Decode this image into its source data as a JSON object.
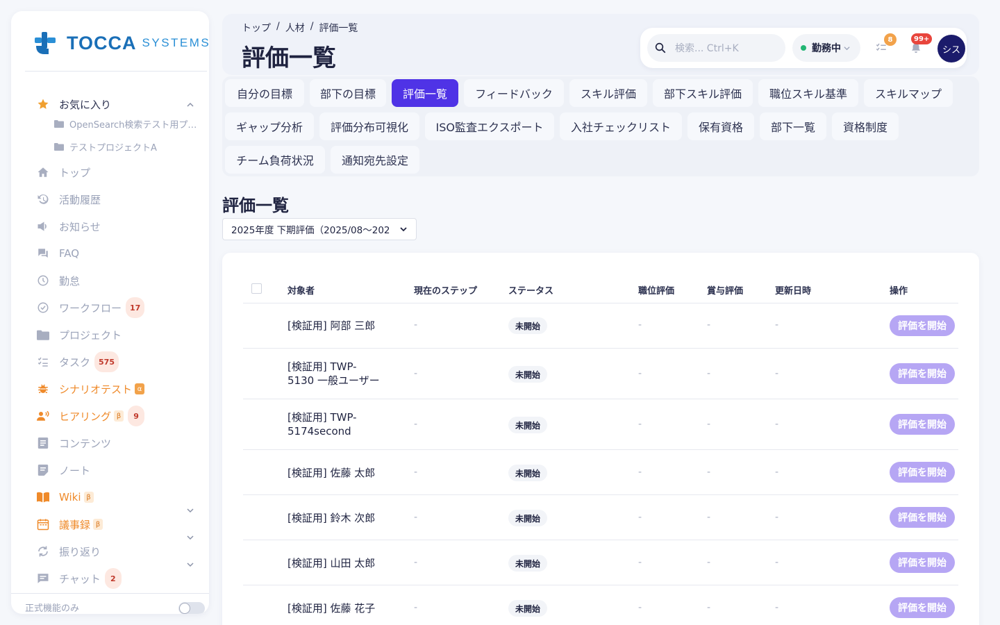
{
  "brand": {
    "name": "TOCCA",
    "sub": "SYSTEMS",
    "colors": {
      "primary": "#1a6fb7",
      "accent": "#4f33e6"
    }
  },
  "sidebar": {
    "favorites": {
      "label": "お気に入り",
      "icon": "star-icon",
      "children": [
        {
          "label": "OpenSearch検索テスト用プ…",
          "icon": "folder-icon"
        },
        {
          "label": "テストプロジェクトA",
          "icon": "folder-icon"
        }
      ]
    },
    "items": [
      {
        "label": "トップ",
        "icon": "home-icon"
      },
      {
        "label": "活動履歴",
        "icon": "history-icon"
      },
      {
        "label": "お知らせ",
        "icon": "megaphone-icon"
      },
      {
        "label": "FAQ",
        "icon": "chat-bubbles-icon"
      },
      {
        "label": "勤怠",
        "icon": "clock-icon"
      },
      {
        "label": "ワークフロー",
        "icon": "check-circle-icon",
        "badge": "17"
      },
      {
        "label": "プロジェクト",
        "icon": "folder-icon"
      },
      {
        "label": "タスク",
        "icon": "checklist-icon",
        "badge": "575"
      },
      {
        "label": "シナリオテスト",
        "icon": "bug-icon",
        "tag": "α"
      },
      {
        "label": "ヒアリング",
        "icon": "speaker-person-icon",
        "tag": "β",
        "badge": "9"
      },
      {
        "label": "コンテンツ",
        "icon": "document-icon"
      },
      {
        "label": "ノート",
        "icon": "note-icon"
      },
      {
        "label": "Wiki",
        "icon": "book-icon",
        "tag": "β"
      },
      {
        "label": "議事録",
        "icon": "calendar-icon",
        "tag": "β"
      },
      {
        "label": "振り返り",
        "icon": "refresh-icon"
      },
      {
        "label": "チャット",
        "icon": "chat-icon",
        "badge": "2"
      }
    ],
    "footer": {
      "label": "正式機能のみ"
    }
  },
  "header": {
    "breadcrumb": [
      "トップ",
      "人材",
      "評価一覧"
    ],
    "separator": "/",
    "title": "評価一覧",
    "search_placeholder": "検索... Ctrl+K",
    "status": "勤務中",
    "task_badge": "8",
    "notification_badge": "99+",
    "avatar": "シス"
  },
  "tabs": [
    "自分の目標",
    "部下の目標",
    "評価一覧",
    "フィードバック",
    "スキル評価",
    "部下スキル評価",
    "職位スキル基準",
    "スキルマップ",
    "ギャップ分析",
    "評価分布可視化",
    "ISO監査エクスポート",
    "入社チェックリスト",
    "保有資格",
    "部下一覧",
    "資格制度",
    "チーム負荷状況",
    "通知宛先設定"
  ],
  "active_tab": "評価一覧",
  "section": {
    "title": "評価一覧",
    "period": "2025年度 下期評価（2025/08～202"
  },
  "table": {
    "columns": [
      "対象者",
      "現在のステップ",
      "ステータス",
      "職位評価",
      "賞与評価",
      "更新日時",
      "操作"
    ],
    "rows": [
      {
        "name": "[検証用] 阿部 三郎",
        "step": "-",
        "status": "未開始",
        "position": "-",
        "bonus": "-",
        "updated": "-",
        "action": "評価を開始"
      },
      {
        "name": "[検証用] TWP-5130 一般ユーザー",
        "name_l1": "[検証用] TWP-",
        "name_l2": "5130 一般ユーザー",
        "step": "-",
        "status": "未開始",
        "position": "-",
        "bonus": "-",
        "updated": "-",
        "action": "評価を開始"
      },
      {
        "name": "[検証用] TWP-5174second",
        "name_l1": "[検証用] TWP-",
        "name_l2": "5174second",
        "step": "-",
        "status": "未開始",
        "position": "-",
        "bonus": "-",
        "updated": "-",
        "action": "評価を開始"
      },
      {
        "name": "[検証用] 佐藤 太郎",
        "step": "-",
        "status": "未開始",
        "position": "-",
        "bonus": "-",
        "updated": "-",
        "action": "評価を開始"
      },
      {
        "name": "[検証用] 鈴木 次郎",
        "step": "-",
        "status": "未開始",
        "position": "-",
        "bonus": "-",
        "updated": "-",
        "action": "評価を開始"
      },
      {
        "name": "[検証用] 山田 太郎",
        "step": "-",
        "status": "未開始",
        "position": "-",
        "bonus": "-",
        "updated": "-",
        "action": "評価を開始"
      },
      {
        "name": "[検証用] 佐藤 花子",
        "step": "-",
        "status": "未開始",
        "position": "-",
        "bonus": "-",
        "updated": "-",
        "action": "評価を開始"
      }
    ]
  }
}
